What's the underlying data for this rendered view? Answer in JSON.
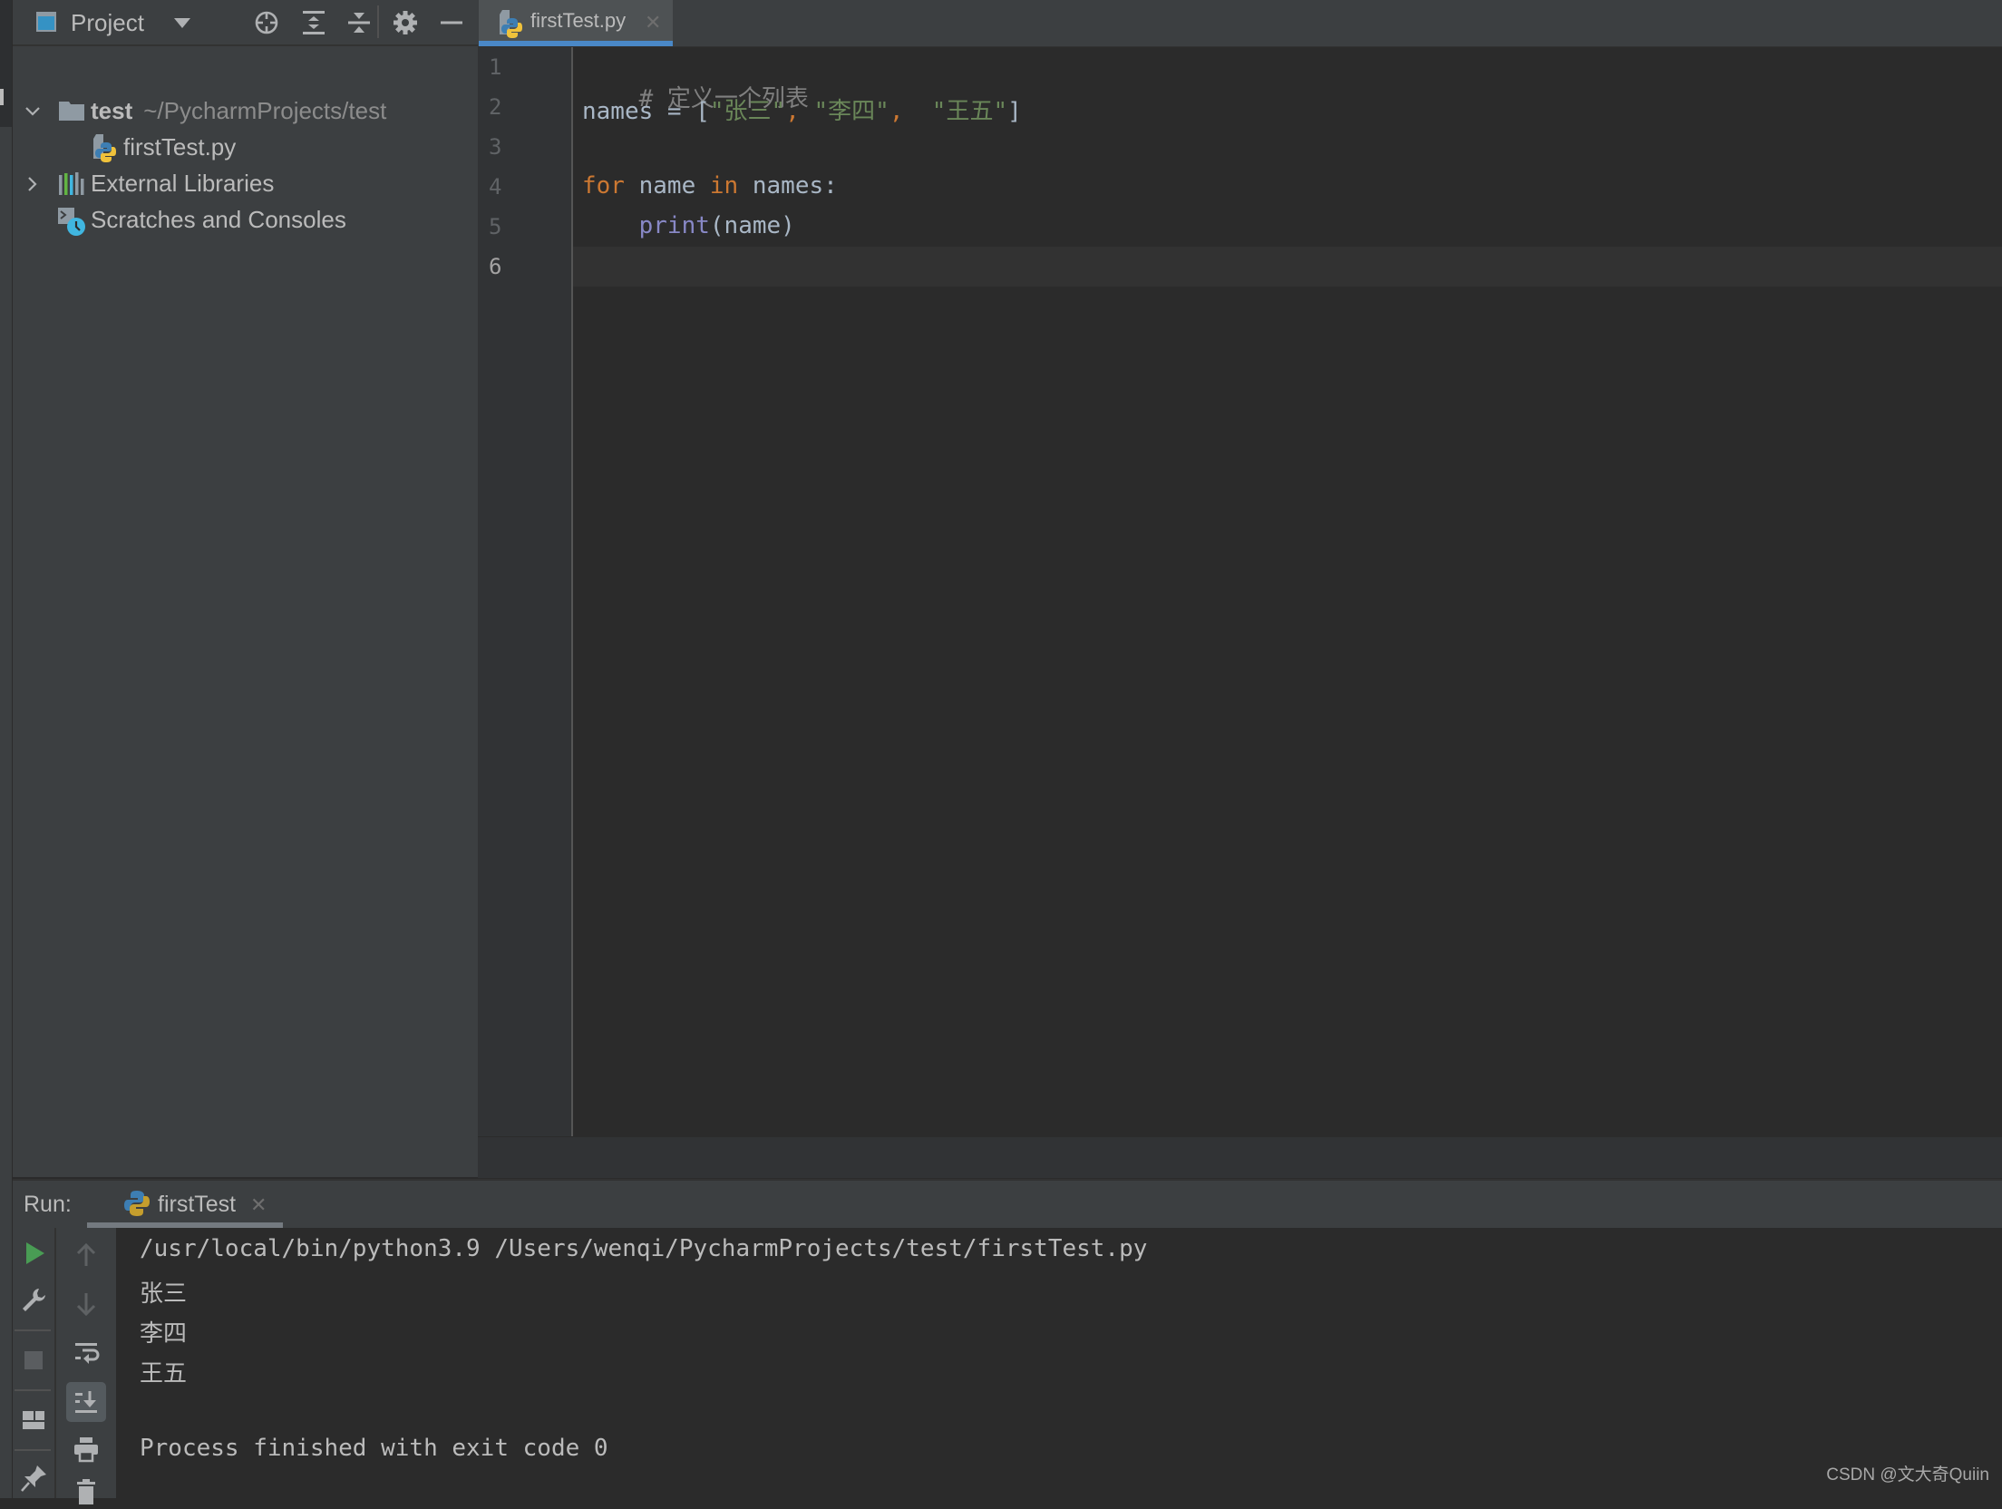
{
  "project_panel": {
    "title": "Project",
    "toolbar": [
      {
        "name": "locate-file-icon"
      },
      {
        "name": "expand-all-icon"
      },
      {
        "name": "collapse-all-icon"
      },
      {
        "name": "gear-icon"
      },
      {
        "name": "hide-icon"
      }
    ],
    "tree": [
      {
        "label": "test",
        "path": "~/PycharmProjects/test",
        "icon": "folder-icon",
        "expanded": true,
        "level": 0
      },
      {
        "label": "firstTest.py",
        "icon": "python-file-icon",
        "level": 1
      },
      {
        "label": "External Libraries",
        "icon": "libraries-icon",
        "expanded": false,
        "level": 0
      },
      {
        "label": "Scratches and Consoles",
        "icon": "scratches-icon",
        "level": 0
      }
    ]
  },
  "editor": {
    "tabs": [
      {
        "label": "firstTest.py",
        "close": "✕",
        "active": true
      }
    ],
    "line_numbers": [
      "1",
      "2",
      "3",
      "4",
      "5",
      "6"
    ],
    "current_line": 6,
    "code": {
      "l1_comment": "# 定义一个列表",
      "l2_var": "names = [",
      "l2_s1": "\"张三\"",
      "l2_c1": ", ",
      "l2_s2": "\"李四\"",
      "l2_c2": ",  ",
      "l2_s3": "\"王五\"",
      "l2_end": "]",
      "l4_for": "for",
      "l4_mid": " name ",
      "l4_in": "in",
      "l4_end": " names:",
      "l5_indent": "    ",
      "l5_print": "print",
      "l5_args": "(name)"
    }
  },
  "run_panel": {
    "label": "Run:",
    "tab_label": "firstTest",
    "tab_close": "✕",
    "left_toolbar": [
      "run-icon",
      "wrench-icon",
      "stop-icon",
      "layout-icon",
      "pin-icon"
    ],
    "right_toolbar": [
      "up-arrow-icon",
      "down-arrow-icon",
      "soft-wrap-icon",
      "scroll-to-end-icon",
      "print-icon",
      "trash-icon"
    ],
    "console": [
      "/usr/local/bin/python3.9 /Users/wenqi/PycharmProjects/test/firstTest.py",
      "张三",
      "李四",
      "王五",
      "",
      "Process finished with exit code 0"
    ]
  },
  "watermark": "CSDN @文大奇Quiin",
  "colors": {
    "accent_tab": "#4a88c7",
    "keyword": "#cc7832",
    "string": "#6a8759",
    "builtin": "#8888c6",
    "comment": "#808080",
    "run_green": "#499c54"
  }
}
